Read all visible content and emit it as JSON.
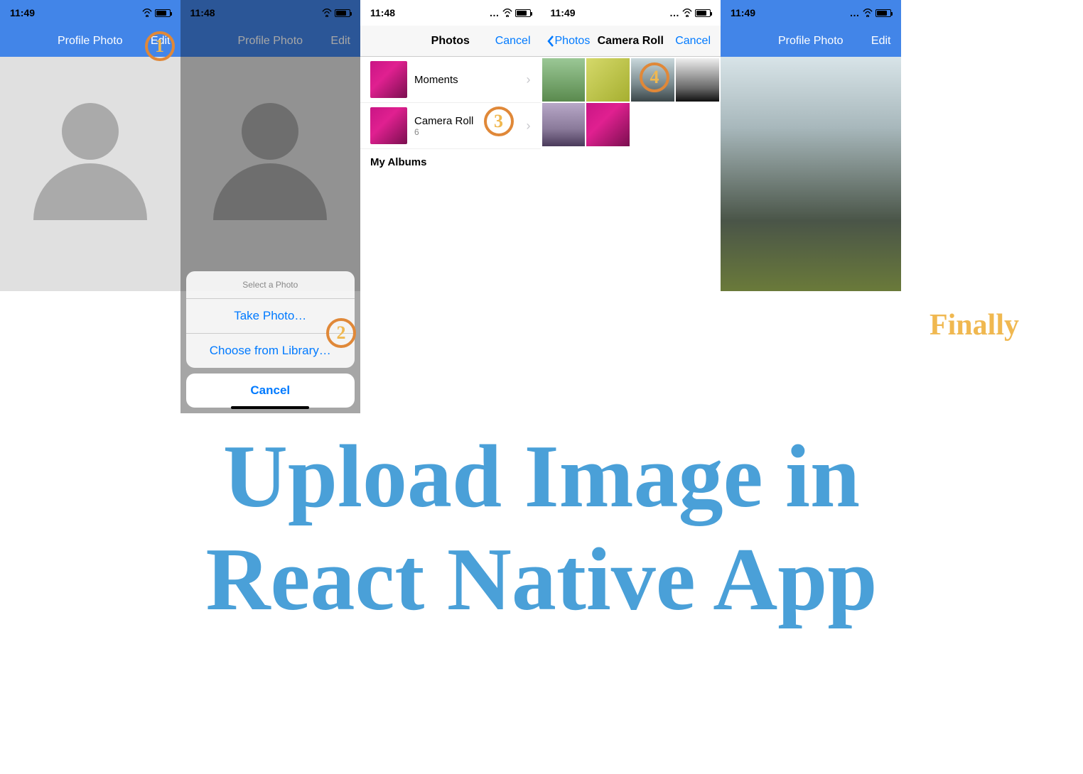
{
  "screens": {
    "s1": {
      "time": "11:49",
      "title": "Profile Photo",
      "edit": "Edit"
    },
    "s2": {
      "time": "11:48",
      "title": "Profile Photo",
      "edit": "Edit",
      "sheet": {
        "header": "Select a Photo",
        "opt1": "Take Photo…",
        "opt2": "Choose from Library…",
        "cancel": "Cancel"
      }
    },
    "s3": {
      "time": "11:48",
      "title": "Photos",
      "cancel": "Cancel",
      "rows": {
        "moments": "Moments",
        "cameraRoll": "Camera Roll",
        "count": "6"
      },
      "section": "My Albums"
    },
    "s4": {
      "time": "11:49",
      "back": "Photos",
      "title": "Camera Roll",
      "cancel": "Cancel"
    },
    "s5": {
      "time": "11:49",
      "title": "Profile Photo",
      "edit": "Edit"
    }
  },
  "badges": {
    "b1": "1",
    "b2": "2",
    "b3": "3",
    "b4": "4"
  },
  "finally": "Finally",
  "mainTitle": {
    "l1": "Upload Image in",
    "l2": "React Native App"
  }
}
